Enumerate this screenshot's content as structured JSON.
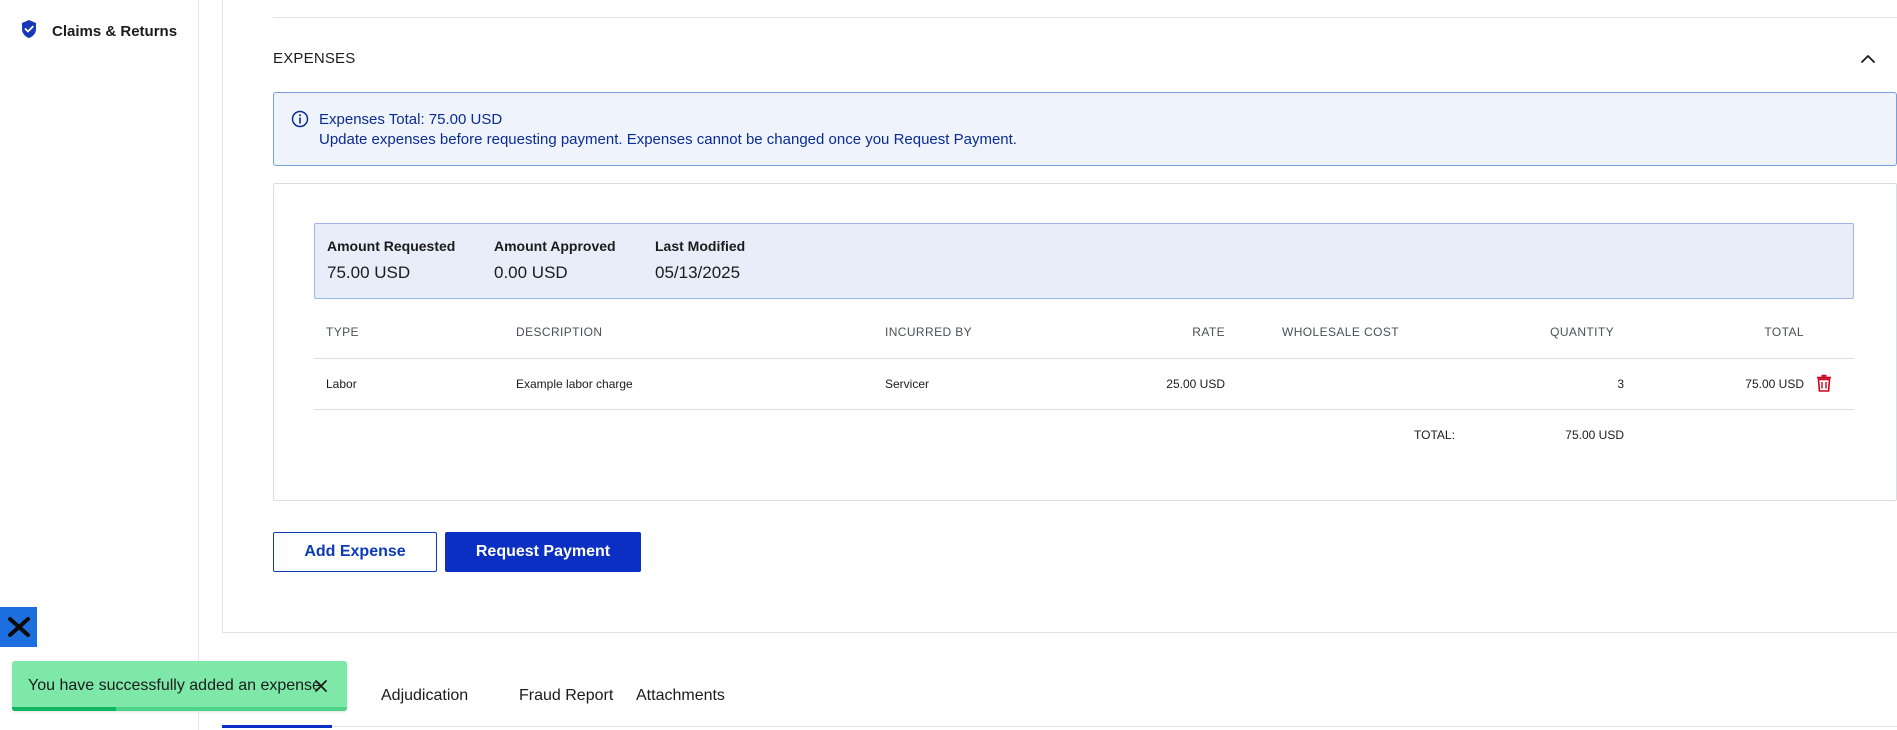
{
  "sidebar": {
    "brand_label": "Claims & Returns",
    "brand_icon": "shield-check-icon",
    "logo_icon": "x-logo-icon"
  },
  "expenses": {
    "section_title": "EXPENSES",
    "collapse_icon": "chevron-up-icon",
    "info": {
      "icon": "info-icon",
      "line1": "Expenses Total: 75.00 USD",
      "line2": "Update expenses before requesting payment. Expenses cannot be changed once you Request Payment."
    },
    "summary": {
      "amount_requested_label": "Amount Requested",
      "amount_requested_value": "75.00 USD",
      "amount_approved_label": "Amount Approved",
      "amount_approved_value": "0.00 USD",
      "last_modified_label": "Last Modified",
      "last_modified_value": "05/13/2025"
    },
    "table": {
      "headers": {
        "type": "TYPE",
        "description": "DESCRIPTION",
        "incurred_by": "INCURRED BY",
        "rate": "RATE",
        "wholesale_cost": "WHOLESALE COST",
        "quantity": "QUANTITY",
        "total": "TOTAL"
      },
      "rows": [
        {
          "type": "Labor",
          "description": "Example labor charge",
          "incurred_by": "Servicer",
          "rate": "25.00 USD",
          "wholesale_cost": "",
          "quantity": "3",
          "total": "75.00 USD",
          "delete_icon": "trash-icon"
        }
      ],
      "footer": {
        "label": "TOTAL:",
        "value": "75.00 USD"
      }
    },
    "buttons": {
      "add_expense": "Add Expense",
      "request_payment": "Request Payment"
    }
  },
  "tabs": {
    "items": [
      "Adjudication",
      "Fraud Report",
      "Attachments"
    ]
  },
  "toast": {
    "message": "You have successfully added an expense",
    "close_icon": "close-icon",
    "progress_fraction": 0.31
  },
  "colors": {
    "primary": "#0a2fc2",
    "info_bg": "#eef3fc",
    "toast_bg": "#7ee8a9",
    "danger": "#d0021b"
  }
}
